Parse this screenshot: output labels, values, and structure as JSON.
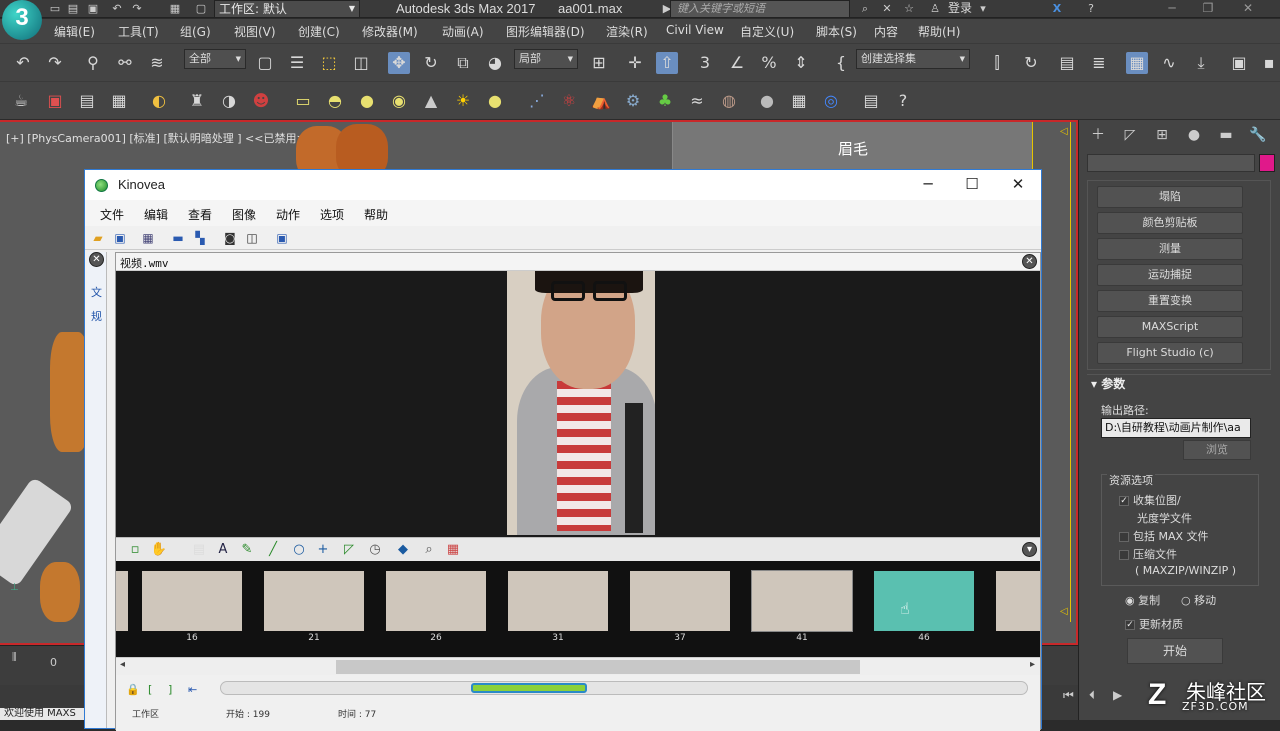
{
  "max": {
    "logo": "3",
    "workspace": "工作区: 默认",
    "app_title": "Autodesk 3ds Max 2017",
    "file_title": "aa001.max",
    "search_placeholder": "键入关键字或短语",
    "login": "登录",
    "menu": [
      "编辑(E)",
      "工具(T)",
      "组(G)",
      "视图(V)",
      "创建(C)",
      "修改器(M)",
      "动画(A)",
      "图形编辑器(D)",
      "渲染(R)",
      "Civil View",
      "自定义(U)",
      "脚本(S)",
      "内容",
      "帮助(H)"
    ],
    "toolbar": {
      "filter_dropdown": "全部",
      "ref_coord_dropdown": "局部",
      "selection_set_dropdown": "创建选择集"
    },
    "viewport": {
      "label": "[+] [PhysCamera001] [标准] [默认明暗处理 ] <<已禁用>>",
      "overlay_title": "眉毛"
    },
    "status": {
      "welcome": "欢迎使用 MAXS",
      "frame_zero": "0"
    },
    "command_panel": {
      "utilities": [
        "塌陷",
        "颜色剪贴板",
        "测量",
        "运动捕捉",
        "重置变换",
        "MAXScript",
        "Flight Studio (c)"
      ],
      "params_header": "参数",
      "output_path_label": "输出路径:",
      "output_path": "D:\\自研教程\\动画片制作\\aa",
      "browse": "浏览",
      "resource_group": "资源选项",
      "collect_bitmaps": "收集位图/",
      "photometric": "光度学文件",
      "include_max": "包括 MAX 文件",
      "compress": "压缩文件",
      "zip_hint": "( MAXZIP/WINZIP )",
      "copy": "复制",
      "move": "移动",
      "update_materials": "更新材质",
      "start": "开始"
    }
  },
  "kinovea": {
    "title": "Kinovea",
    "menu": [
      "文件",
      "编辑",
      "查看",
      "图像",
      "动作",
      "选项",
      "帮助"
    ],
    "left_tabs": [
      "文",
      "规"
    ],
    "file_name": "视频.wmv",
    "thumb_labels": [
      "16",
      "21",
      "26",
      "31",
      "37",
      "41",
      "46"
    ],
    "bottom": {
      "workzone": "工作区",
      "start": "开始 : 199",
      "time": "时间 : 77"
    }
  },
  "watermark": {
    "main": "朱峰社区",
    "sub": "ZF3D.COM"
  }
}
